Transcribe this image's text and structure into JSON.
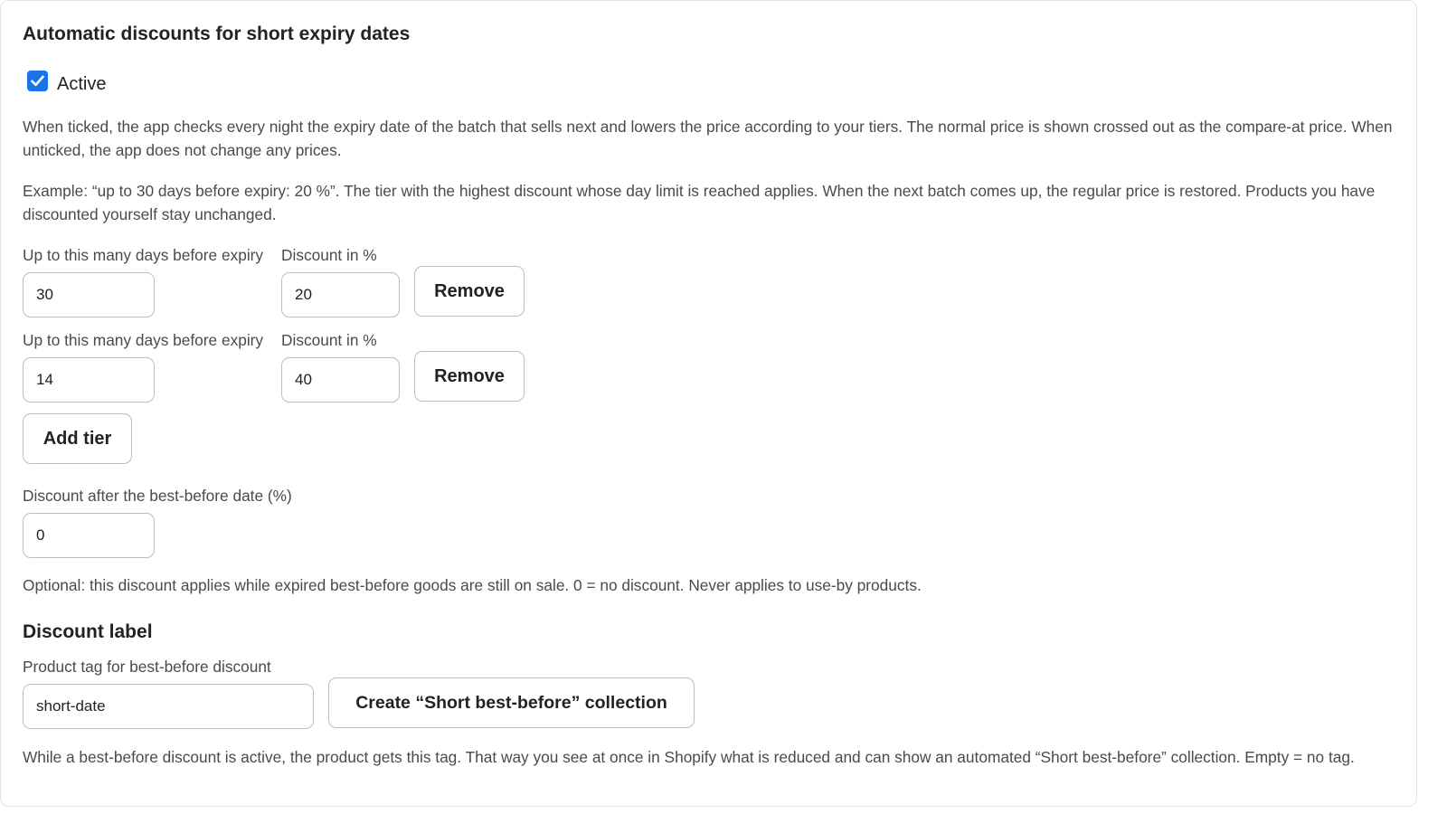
{
  "settings": {
    "title": "Automatic discounts for short expiry dates",
    "active": {
      "label": "Active",
      "checked": true
    },
    "description_1": "When ticked, the app checks every night the expiry date of the batch that sells next and lowers the price according to your tiers. The normal price is shown crossed out as the compare-at price. When unticked, the app does not change any prices.",
    "description_2": "Example: “up to 30 days before expiry: 20 %”. The tier with the highest discount whose day limit is reached applies. When the next batch comes up, the regular price is restored. Products you have discounted yourself stay unchanged.",
    "tiers": [
      {
        "days_label": "Up to this many days before expiry",
        "days_value": "30",
        "discount_label": "Discount in %",
        "discount_value": "20",
        "remove_label": "Remove"
      },
      {
        "days_label": "Up to this many days before expiry",
        "days_value": "14",
        "discount_label": "Discount in %",
        "discount_value": "40",
        "remove_label": "Remove"
      }
    ],
    "add_tier_label": "Add tier",
    "after_bbd": {
      "label": "Discount after the best-before date (%)",
      "value": "0",
      "help": "Optional: this discount applies while expired best-before goods are still on sale. 0 = no discount. Never applies to use-by products."
    },
    "discount_label_section": {
      "title": "Discount label",
      "tag_label": "Product tag for best-before discount",
      "tag_value": "short-date",
      "create_collection_label": "Create “Short best-before” collection",
      "help": "While a best-before discount is active, the product gets this tag. That way you see at once in Shopify what is reduced and can show an automated “Short best-before” collection. Empty = no tag."
    }
  },
  "colors": {
    "accent": "#1a73e8",
    "text": "#222222",
    "muted_text": "#4a4a4a",
    "border": "#bdbdbd"
  }
}
